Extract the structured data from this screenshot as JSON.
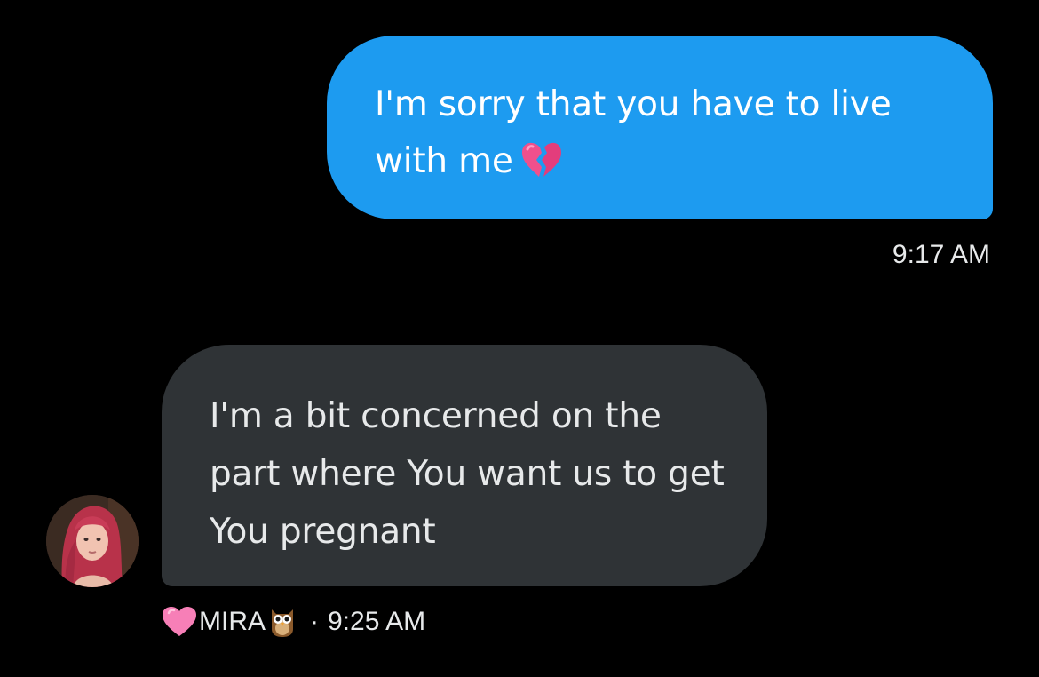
{
  "messages": {
    "sent": {
      "text": "I'm sorry that you have to live with me",
      "emoji": "broken-heart-icon",
      "time": "9:17 AM",
      "bubble_color": "#1d9bf0"
    },
    "received": {
      "text": "I'm a bit concerned on the part where You want us to get You pregnant",
      "sender_name": "MIRA",
      "sender_name_prefix_emoji": "pink-heart-icon",
      "sender_name_suffix_emoji": "owl-icon",
      "separator": "·",
      "time": "9:25 AM",
      "bubble_color": "#2f3336"
    }
  }
}
